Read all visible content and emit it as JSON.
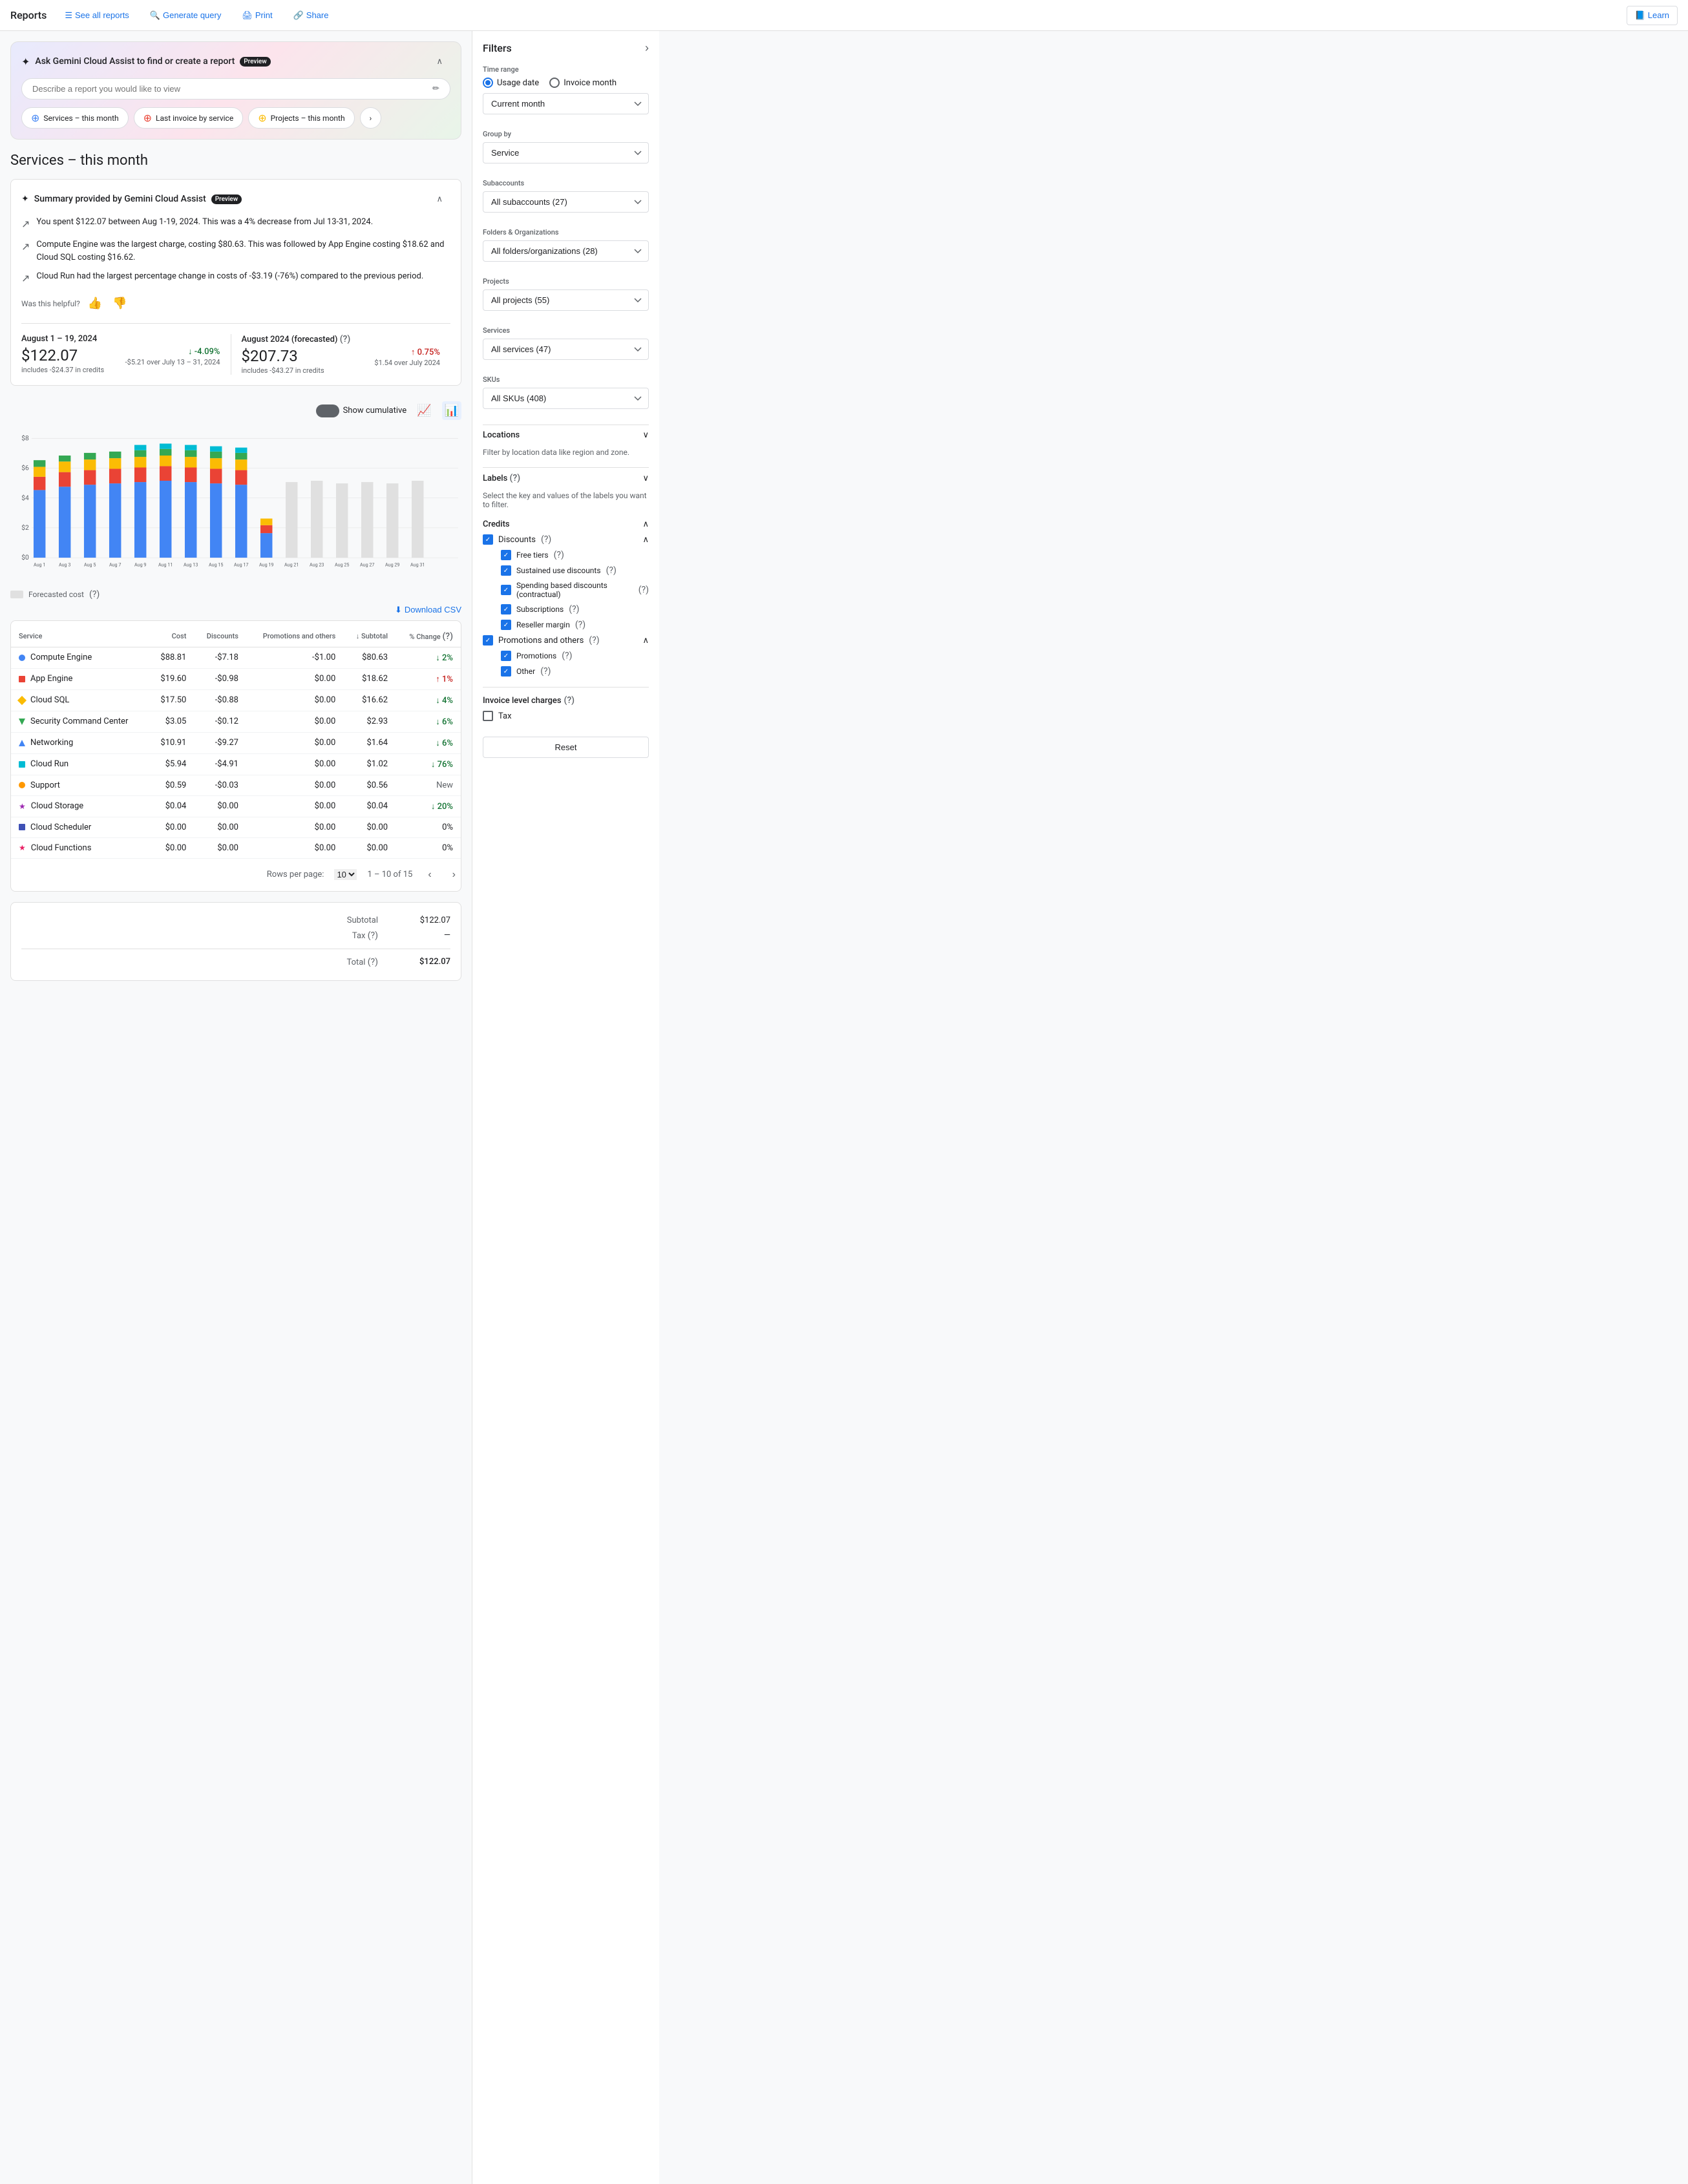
{
  "nav": {
    "title": "Reports",
    "see_all_reports": "See all reports",
    "generate_query": "Generate query",
    "print": "Print",
    "share": "Share",
    "learn": "Learn"
  },
  "gemini": {
    "title": "Ask Gemini Cloud Assist to find or create a report",
    "preview": "Preview",
    "input_placeholder": "Describe a report you would like to view",
    "chips": [
      {
        "label": "Services – this month",
        "color": "#4285f4"
      },
      {
        "label": "Last invoice by service",
        "color": "#ea4335"
      },
      {
        "label": "Projects – this month",
        "color": "#fbbc04"
      }
    ]
  },
  "page": {
    "title": "Services – this month"
  },
  "summary": {
    "title": "Summary provided by Gemini Cloud Assist",
    "preview": "Preview",
    "items": [
      "You spent $122.07 between Aug 1-19, 2024. This was a 4% decrease from Jul 13-31, 2024.",
      "Compute Engine was the largest charge, costing $80.63. This was followed by App Engine costing $18.62 and Cloud SQL costing $16.62.",
      "Cloud Run had the largest percentage change in costs of -$3.19 (-76%) compared to the previous period."
    ],
    "feedback_label": "Was this helpful?"
  },
  "metric_current": {
    "period": "August 1 – 19, 2024",
    "value": "$122.07",
    "sub": "includes -$24.37 in credits",
    "change": "↓ -4.09%",
    "change_type": "down",
    "change_sub": "-$5.21 over July 13 – 31, 2024"
  },
  "metric_forecast": {
    "period": "August 2024 (forecasted)",
    "value": "$207.73",
    "sub": "includes -$43.27 in credits",
    "change": "↑ 0.75%",
    "change_type": "up",
    "change_sub": "$1.54 over July 2024"
  },
  "chart": {
    "show_cumulative": "Show cumulative",
    "y_labels": [
      "$8",
      "$6",
      "$4",
      "$2",
      "$0"
    ],
    "x_labels": [
      "Aug 1",
      "Aug 3",
      "Aug 5",
      "Aug 7",
      "Aug 9",
      "Aug 11",
      "Aug 13",
      "Aug 15",
      "Aug 17",
      "Aug 19",
      "Aug 21",
      "Aug 23",
      "Aug 25",
      "Aug 27",
      "Aug 29",
      "Aug 31"
    ],
    "forecasted_label": "Forecasted cost"
  },
  "download": {
    "label": "Download CSV"
  },
  "table": {
    "columns": [
      "Service",
      "Cost",
      "Discounts",
      "Promotions and others",
      "Subtotal",
      "% Change"
    ],
    "rows": [
      {
        "service": "Compute Engine",
        "color": "#4285f4",
        "shape": "circle",
        "cost": "$88.81",
        "discounts": "-$7.18",
        "promos": "-$1.00",
        "subtotal": "$80.63",
        "change": "↓ 2%",
        "change_type": "down"
      },
      {
        "service": "App Engine",
        "color": "#ea4335",
        "shape": "square",
        "cost": "$19.60",
        "discounts": "-$0.98",
        "promos": "$0.00",
        "subtotal": "$18.62",
        "change": "↑ 1%",
        "change_type": "up"
      },
      {
        "service": "Cloud SQL",
        "color": "#fbbc04",
        "shape": "diamond",
        "cost": "$17.50",
        "discounts": "-$0.88",
        "promos": "$0.00",
        "subtotal": "$16.62",
        "change": "↓ 4%",
        "change_type": "down"
      },
      {
        "service": "Security Command Center",
        "color": "#34a853",
        "shape": "triangle",
        "cost": "$3.05",
        "discounts": "-$0.12",
        "promos": "$0.00",
        "subtotal": "$2.93",
        "change": "↓ 6%",
        "change_type": "down"
      },
      {
        "service": "Networking",
        "color": "#4285f4",
        "shape": "triangle-up",
        "cost": "$10.91",
        "discounts": "-$9.27",
        "promos": "$0.00",
        "subtotal": "$1.64",
        "change": "↓ 6%",
        "change_type": "down"
      },
      {
        "service": "Cloud Run",
        "color": "#00bcd4",
        "shape": "square",
        "cost": "$5.94",
        "discounts": "-$4.91",
        "promos": "$0.00",
        "subtotal": "$1.02",
        "change": "↓ 76%",
        "change_type": "down"
      },
      {
        "service": "Support",
        "color": "#ff9800",
        "shape": "circle",
        "cost": "$0.59",
        "discounts": "-$0.03",
        "promos": "$0.00",
        "subtotal": "$0.56",
        "change": "New",
        "change_type": "new"
      },
      {
        "service": "Cloud Storage",
        "color": "#9c27b0",
        "shape": "star",
        "cost": "$0.04",
        "discounts": "$0.00",
        "promos": "$0.00",
        "subtotal": "$0.04",
        "change": "↓ 20%",
        "change_type": "down"
      },
      {
        "service": "Cloud Scheduler",
        "color": "#3f51b5",
        "shape": "square",
        "cost": "$0.00",
        "discounts": "$0.00",
        "promos": "$0.00",
        "subtotal": "$0.00",
        "change": "0%",
        "change_type": "neutral"
      },
      {
        "service": "Cloud Functions",
        "color": "#e91e63",
        "shape": "star",
        "cost": "$0.00",
        "discounts": "$0.00",
        "promos": "$0.00",
        "subtotal": "$0.00",
        "change": "0%",
        "change_type": "neutral"
      }
    ],
    "pagination": {
      "rows_per_page": "10",
      "range": "1 – 10 of 15"
    }
  },
  "totals": {
    "subtotal_label": "Subtotal",
    "subtotal_value": "$122.07",
    "tax_label": "Tax",
    "tax_value": "—",
    "total_label": "Total",
    "total_value": "$122.07"
  },
  "filters": {
    "title": "Filters",
    "time_range_label": "Time range",
    "usage_date": "Usage date",
    "invoice_month": "Invoice month",
    "current_month": "Current month",
    "group_by_label": "Group by",
    "group_by_value": "Service",
    "subaccounts_label": "Subaccounts",
    "subaccounts_value": "All subaccounts (27)",
    "folders_label": "Folders & Organizations",
    "folders_value": "All folders/organizations (28)",
    "projects_label": "Projects",
    "projects_value": "All projects (55)",
    "services_label": "Services",
    "services_value": "All services (47)",
    "skus_label": "SKUs",
    "skus_value": "All SKUs (408)",
    "locations_label": "Locations",
    "locations_sublabel": "Filter by location data like region and zone.",
    "labels_label": "Labels",
    "labels_sublabel": "Select the key and values of the labels you want to filter.",
    "credits_label": "Credits",
    "discounts_label": "Discounts",
    "free_tiers": "Free tiers",
    "sustained_use": "Sustained use discounts",
    "spending_based": "Spending based discounts (contractual)",
    "subscriptions": "Subscriptions",
    "reseller_margin": "Reseller margin",
    "promotions_and_others": "Promotions and others",
    "promotions": "Promotions",
    "other": "Other",
    "invoice_charges_label": "Invoice level charges",
    "tax_label_filter": "Tax",
    "reset_btn": "Reset"
  }
}
